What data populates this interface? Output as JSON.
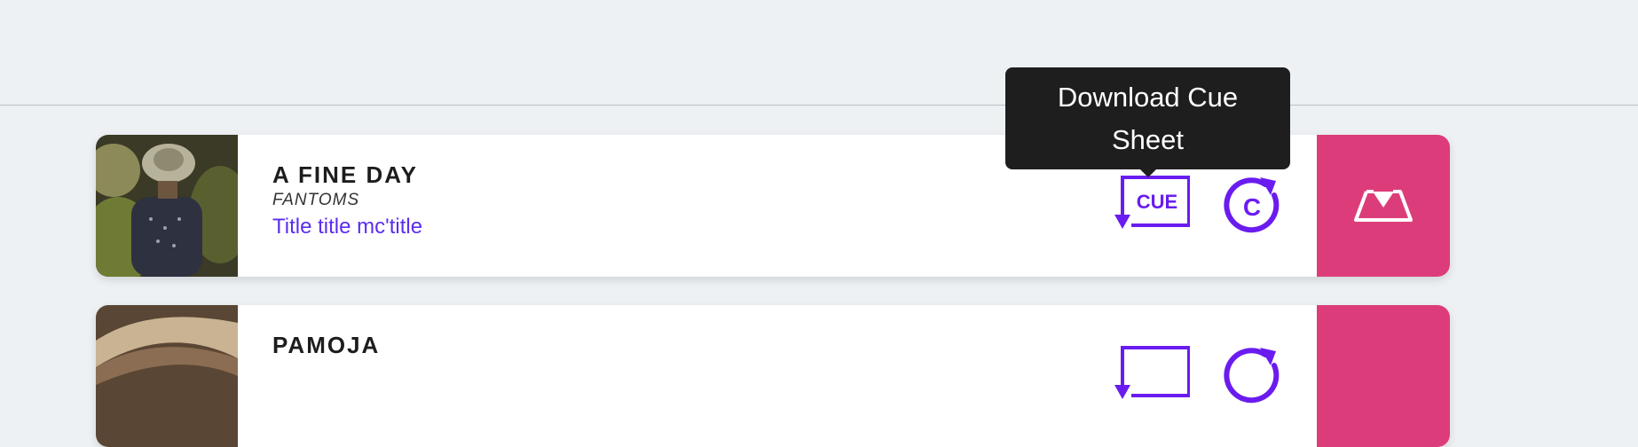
{
  "tooltip": {
    "text": "Download Cue Sheet"
  },
  "tracks": [
    {
      "title": "A FINE DAY",
      "artist": "FANTOMS",
      "subtitle": "Title title mc'title",
      "cue_label": "CUE",
      "c_label": "C"
    },
    {
      "title": "PAMOJA"
    }
  ],
  "colors": {
    "background": "#eef1f4",
    "accent_purple": "#6a1cf0",
    "subtitle_purple": "#5b2df0",
    "action_pink": "#dc3d7a",
    "tooltip_bg": "#1e1e1e"
  },
  "icons": {
    "cue": "download-cue-sheet-icon",
    "c": "c-circle-refresh-icon",
    "action": "upload-tray-icon"
  }
}
